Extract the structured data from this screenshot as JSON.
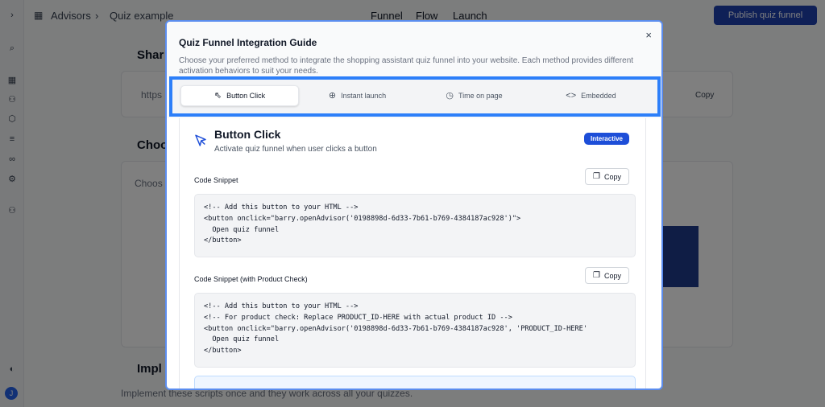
{
  "app": {
    "breadcrumb": {
      "advisors": "Advisors",
      "quiz": "Quiz example"
    },
    "top_nav": [
      "Funnel",
      "Flow",
      "Launch"
    ],
    "publish_label": "Publish quiz funnel",
    "bg_share_title": "Shar",
    "bg_choose_title": "Choo",
    "bg_choose_text": "Choos",
    "bg_url_fragment": "https",
    "bg_copy_label": "Copy",
    "bg_impl_title": "Impl",
    "bg_impl_text": "Implement these scripts once and they work across all your quizzes.",
    "avatar_letter": "J"
  },
  "modal": {
    "title": "Quiz Funnel Integration Guide",
    "description": "Choose your preferred method to integrate the shopping assistant quiz funnel into your website. Each method provides different activation behaviors to suit your needs.",
    "close_symbol": "×",
    "tabs": [
      {
        "label": "Button Click",
        "icon": "cursor-icon",
        "glyph": "⇖"
      },
      {
        "label": "Instant launch",
        "icon": "globe-icon",
        "glyph": "⊕"
      },
      {
        "label": "Time on page",
        "icon": "clock-icon",
        "glyph": "◷"
      },
      {
        "label": "Embedded",
        "icon": "code-icon",
        "glyph": "<>"
      }
    ],
    "method": {
      "title": "Button Click",
      "subtitle": "Activate quiz funnel when user clicks a button",
      "badge": "Interactive"
    },
    "snippets": [
      {
        "label": "Code Snippet",
        "copy_label": "Copy",
        "code": "<!-- Add this button to your HTML -->\n<button onclick=\"barry.openAdvisor('0198898d-6d33-7b61-b769-4384187ac928')\">\n  Open quiz funnel\n</button>"
      },
      {
        "label": "Code Snippet (with Product Check)",
        "copy_label": "Copy",
        "code": "<!-- Add this button to your HTML -->\n<!-- For product check: Replace PRODUCT_ID-HERE with actual product ID -->\n<button onclick=\"barry.openAdvisor('0198898d-6d33-7b61-b769-4384187ac928', 'PRODUCT_ID-HERE'\n  Open quiz funnel\n</button>"
      }
    ]
  },
  "colors": {
    "accent": "#1d4ed8",
    "highlight": "#2d7ff9"
  }
}
